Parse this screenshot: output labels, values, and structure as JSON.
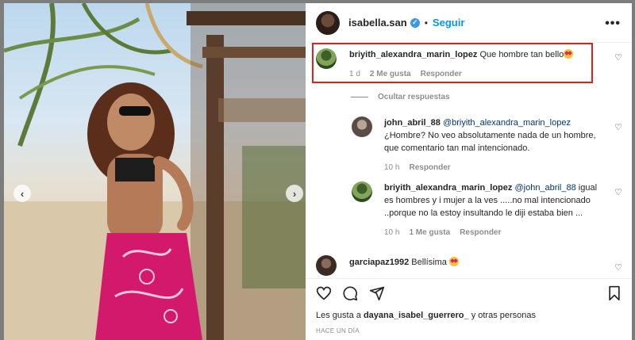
{
  "header": {
    "username": "isabella.san",
    "verified_glyph": "✓",
    "separator": "•",
    "follow_label": "Seguir",
    "more_label": "•••"
  },
  "photo": {
    "nav_prev": "‹",
    "nav_next": "›"
  },
  "comments": [
    {
      "username": "briyith_alexandra_marin_lopez",
      "text": "Que hombre tan bello",
      "emoji": "heart-eyes",
      "time": "1 d",
      "likes": "2 Me gusta",
      "reply": "Responder"
    },
    {
      "username": "john_abril_88",
      "mention": "@briyith_alexandra_marin_lopez",
      "text": "¿Hombre? No veo absolutamente nada de un hombre, que comentario tan mal intencionado.",
      "time": "10 h",
      "reply": "Responder"
    },
    {
      "username": "briyith_alexandra_marin_lopez",
      "mention": "@john_abril_88",
      "text_l1": "igual",
      "text_l2": "es hombres y i mujer a la ves .....no mal intencionado",
      "text_l3": "..porque no la estoy insultando le diji estaba bien ...",
      "time": "10 h",
      "likes": "1 Me gusta",
      "reply": "Responder"
    },
    {
      "username": "garciapaz1992",
      "text": "Bellísima",
      "emoji": "heart-eyes"
    }
  ],
  "hide_replies": "Ocultar respuestas",
  "likes": {
    "prefix": "Les gusta a",
    "user": "dayana_isabel_guerrero_",
    "suffix": "y otras personas"
  },
  "time_ago": "HACE UN DÍA",
  "colors": {
    "follow": "#0095f6",
    "highlight": "#e0201b",
    "mention": "#00376b"
  },
  "icons": [
    "heart-icon",
    "comment-icon",
    "share-icon",
    "bookmark-icon",
    "more-icon",
    "verified-icon"
  ]
}
